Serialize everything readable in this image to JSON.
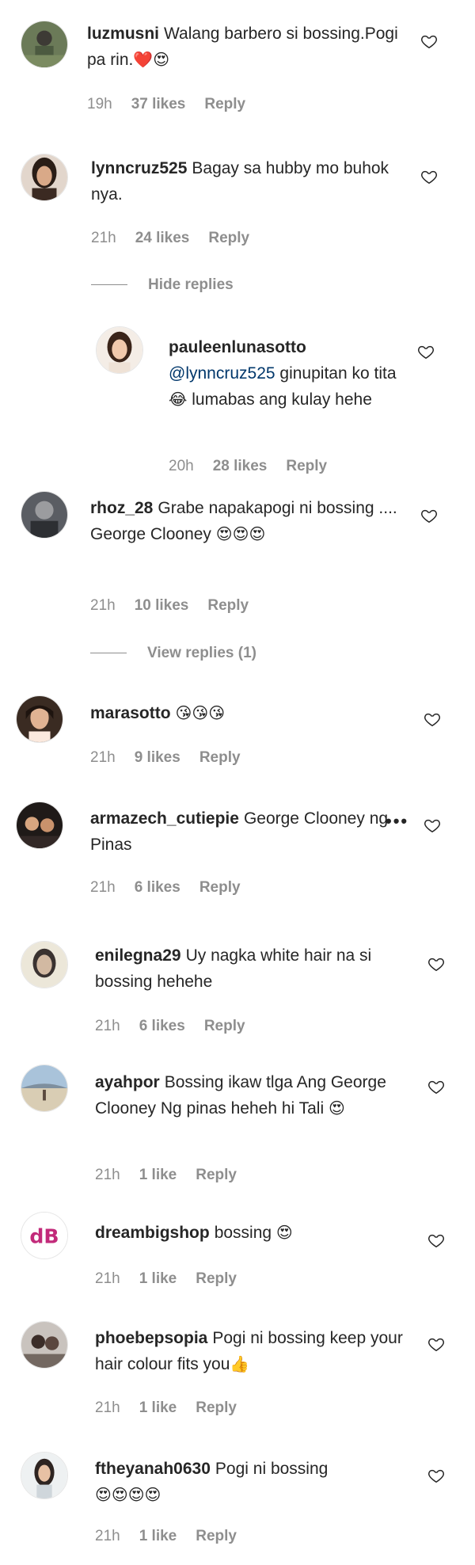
{
  "comments": [
    {
      "username": "luzmusni",
      "text": "Walang barbero si bossing.Pogi pa rin.",
      "emoji": "❤️😍",
      "time": "19h",
      "likes": "37 likes",
      "reply": "Reply"
    },
    {
      "username": "lynncruz525",
      "text": "Bagay sa hubby mo buhok nya.",
      "time": "21h",
      "likes": "24 likes",
      "reply": "Reply",
      "toggle": "Hide replies"
    },
    {
      "username": "pauleenlunasotto",
      "mention": "@lynncruz525",
      "text": "ginupitan ko tita",
      "emoji": "😂",
      "text2": "lumabas ang kulay hehe",
      "time": "20h",
      "likes": "28 likes",
      "reply": "Reply"
    },
    {
      "username": "rhoz_28",
      "text": "Grabe napakapogi ni bossing .... George Clooney",
      "emoji": "😍😍😍",
      "time": "21h",
      "likes": "10 likes",
      "reply": "Reply",
      "toggle": "View replies (1)"
    },
    {
      "username": "marasotto",
      "emoji": "😘😘😘",
      "time": "21h",
      "likes": "9 likes",
      "reply": "Reply"
    },
    {
      "username": "armazech_cutiepie",
      "text": "George Clooney ng Pinas",
      "time": "21h",
      "likes": "6 likes",
      "reply": "Reply"
    },
    {
      "username": "enilegna29",
      "text": "Uy nagka white hair na si bossing hehehe",
      "time": "21h",
      "likes": "6 likes",
      "reply": "Reply"
    },
    {
      "username": "ayahpor",
      "text": "Bossing ikaw tlga Ang George Clooney Ng pinas heheh hi Tali",
      "emoji": "😍",
      "time": "21h",
      "likes": "1 like",
      "reply": "Reply"
    },
    {
      "username": "dreambigshop",
      "text": "bossing",
      "emoji": "😍",
      "time": "21h",
      "likes": "1 like",
      "reply": "Reply"
    },
    {
      "username": "phoebepsopia",
      "text": "Pogi ni bossing keep your hair colour fits you",
      "emoji": "👍",
      "time": "21h",
      "likes": "1 like",
      "reply": "Reply"
    },
    {
      "username": "ftheyanah0630",
      "text": "Pogi ni bossing",
      "emoji": "😍😍😍😍",
      "time": "21h",
      "likes": "1 like",
      "reply": "Reply"
    }
  ],
  "icons": {
    "like": "heart-outline-icon",
    "more": "more-options-icon"
  },
  "colors": {
    "username": "#262626",
    "meta": "#8e8e8e",
    "mention": "#00376b",
    "heart": "#ed1c24"
  }
}
